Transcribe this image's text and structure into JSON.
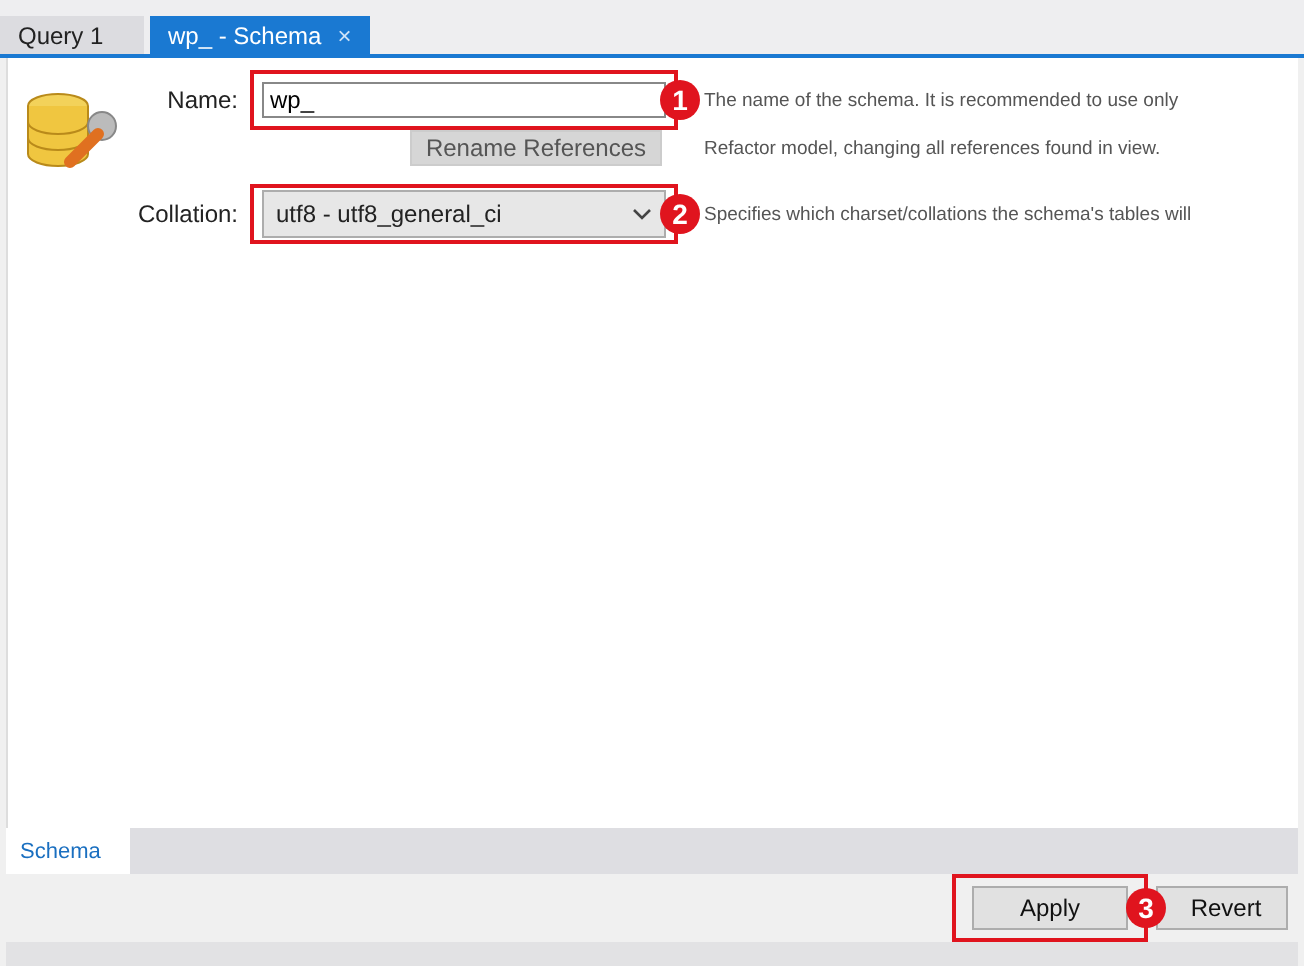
{
  "tabs": [
    {
      "label": "Query 1",
      "selected": false
    },
    {
      "label": "wp_ - Schema",
      "selected": true,
      "close": "×"
    }
  ],
  "form": {
    "name": {
      "label": "Name:",
      "value": "wp_",
      "callout": "1",
      "help": "The name of the schema. It is recommended to use only"
    },
    "rename_button": {
      "label": "Rename References",
      "disabled": true,
      "help": "Refactor model, changing all references found in view."
    },
    "collation": {
      "label": "Collation:",
      "value": "utf8 - utf8_general_ci",
      "callout": "2",
      "help": "Specifies which charset/collations the schema's tables will"
    }
  },
  "bottom_tabs": [
    {
      "label": "Schema",
      "selected": true
    }
  ],
  "buttons": [
    {
      "label": "Apply",
      "callout": "3"
    },
    {
      "label": "Revert"
    }
  ]
}
